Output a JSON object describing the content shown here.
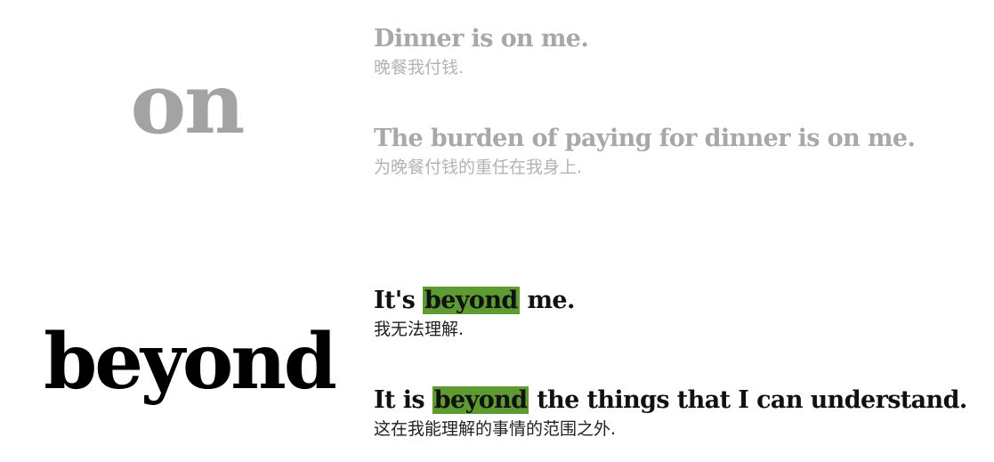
{
  "entries": [
    {
      "word": "on",
      "examples": [
        {
          "en": "Dinner is on me.",
          "zh": "晚餐我付钱."
        },
        {
          "en": "The burden of paying for dinner is on me.",
          "zh": "为晚餐付钱的重任在我身上."
        }
      ]
    },
    {
      "word": "beyond",
      "highlight_color": "#5e9b33",
      "examples": [
        {
          "en_before": "It's ",
          "en_highlight": "beyond",
          "en_after": " me.",
          "zh": "我无法理解."
        },
        {
          "en_before": "It is ",
          "en_highlight": "beyond",
          "en_after": " the things that I can understand.",
          "zh": "这在我能理解的事情的范围之外."
        }
      ]
    }
  ],
  "colors": {
    "muted_text": "#a8a8a8",
    "dark_text": "#111111"
  }
}
